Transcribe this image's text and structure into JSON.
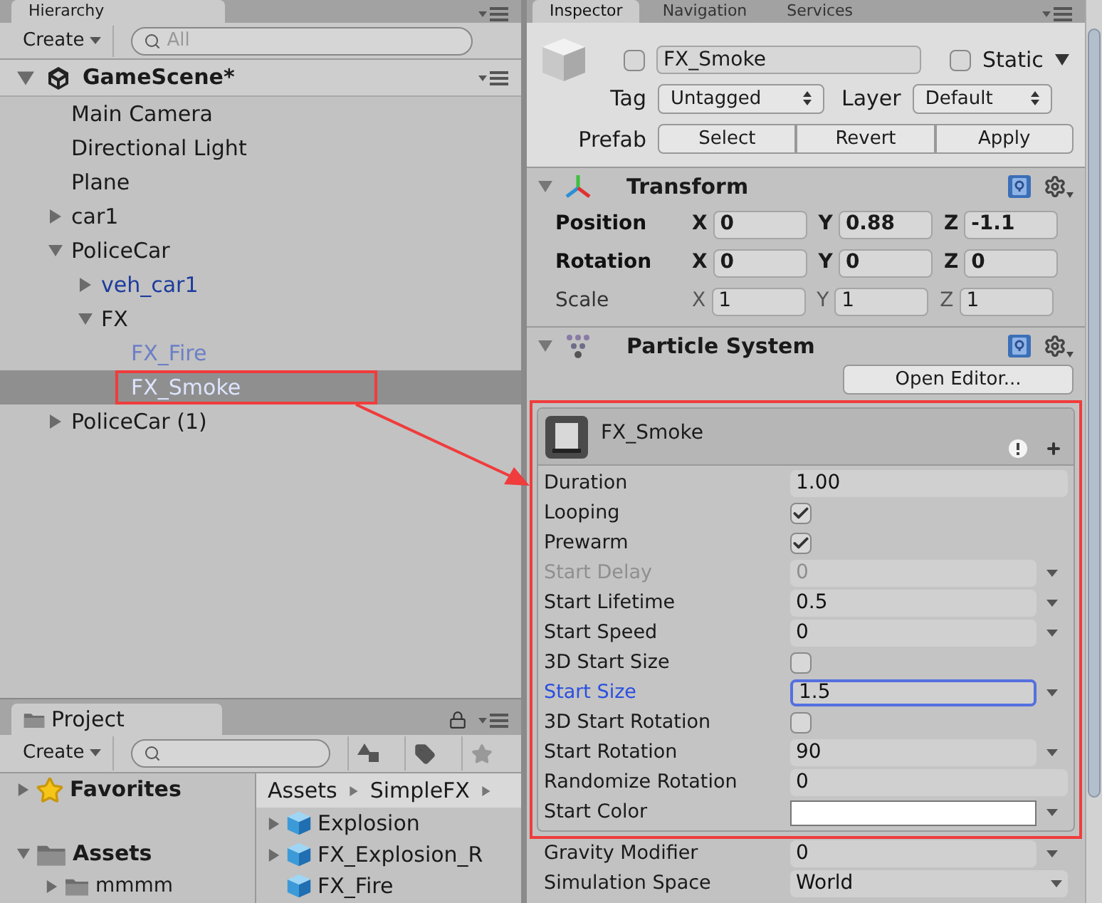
{
  "hierarchy": {
    "tab": "Hierarchy",
    "create_button": "Create",
    "search_placeholder": "All",
    "scene": {
      "name": "GameScene*",
      "expanded": true
    },
    "items": [
      {
        "label": "Main Camera",
        "kind": "object",
        "selected": false,
        "annotated": false
      },
      {
        "label": "Directional Light",
        "kind": "object",
        "selected": false,
        "annotated": false
      },
      {
        "label": "Plane",
        "kind": "object",
        "selected": false,
        "annotated": false
      },
      {
        "label": "car1",
        "kind": "object",
        "expanded": false,
        "selected": false,
        "annotated": false
      },
      {
        "label": "PoliceCar",
        "kind": "object",
        "expanded": true,
        "selected": false,
        "annotated": false,
        "children": [
          {
            "label": "veh_car1",
            "kind": "prefab",
            "expanded": false,
            "selected": false,
            "annotated": false
          },
          {
            "label": "FX",
            "kind": "object",
            "expanded": true,
            "selected": false,
            "annotated": false,
            "children": [
              {
                "label": "FX_Fire",
                "kind": "prefab_broken",
                "selected": false,
                "annotated": false
              },
              {
                "label": "FX_Smoke",
                "kind": "prefab_broken",
                "selected": true,
                "annotated": true
              }
            ]
          }
        ]
      },
      {
        "label": "PoliceCar (1)",
        "kind": "object",
        "expanded": false,
        "selected": false,
        "annotated": false
      }
    ]
  },
  "project": {
    "tab": "Project",
    "create_button": "Create",
    "folders": [
      {
        "label": "Favorites",
        "kind": "favorites",
        "expanded": false
      },
      {
        "label": "Assets",
        "kind": "folder",
        "expanded": true,
        "children": [
          {
            "label": "mmmm",
            "kind": "folder",
            "expanded": false
          }
        ]
      }
    ],
    "breadcrumb": [
      "Assets",
      "SimpleFX"
    ],
    "assets": [
      {
        "label": "Explosion",
        "expanded": false
      },
      {
        "label": "FX_Explosion_R",
        "expanded": false
      },
      {
        "label": "FX_Fire"
      }
    ]
  },
  "inspector": {
    "tabs": [
      {
        "label": "Inspector",
        "selected": true
      },
      {
        "label": "Navigation",
        "selected": false
      },
      {
        "label": "Services",
        "selected": false
      }
    ],
    "object": {
      "active": false,
      "name": "FX_Smoke",
      "static": false,
      "static_label": "Static",
      "tag_label": "Tag",
      "tag": "Untagged",
      "layer_label": "Layer",
      "layer": "Default",
      "prefab_label": "Prefab",
      "prefab_buttons": [
        "Select",
        "Revert",
        "Apply"
      ]
    },
    "transform": {
      "title": "Transform",
      "expanded": true,
      "rows": [
        {
          "label": "Position",
          "modified": true,
          "axes": [
            {
              "axis": "X",
              "value": "0"
            },
            {
              "axis": "Y",
              "value": "0.88"
            },
            {
              "axis": "Z",
              "value": "-1.1"
            }
          ]
        },
        {
          "label": "Rotation",
          "modified": true,
          "axes": [
            {
              "axis": "X",
              "value": "0"
            },
            {
              "axis": "Y",
              "value": "0"
            },
            {
              "axis": "Z",
              "value": "0"
            }
          ]
        },
        {
          "label": "Scale",
          "modified": false,
          "axes": [
            {
              "axis": "X",
              "value": "1"
            },
            {
              "axis": "Y",
              "value": "1"
            },
            {
              "axis": "Z",
              "value": "1"
            }
          ]
        }
      ]
    },
    "particle_system": {
      "title": "Particle System",
      "expanded": true,
      "open_editor_button": "Open Editor...",
      "annotated": true,
      "module": {
        "title": "FX_Smoke",
        "properties": [
          {
            "label": "Duration",
            "kind": "number",
            "value": "1.00",
            "menu": false,
            "disabled": false,
            "focused": false
          },
          {
            "label": "Looping",
            "kind": "checkbox",
            "checked": true,
            "menu": false,
            "disabled": false,
            "focused": false
          },
          {
            "label": "Prewarm",
            "kind": "checkbox",
            "checked": true,
            "menu": false,
            "disabled": false,
            "focused": false
          },
          {
            "label": "Start Delay",
            "kind": "number",
            "value": "0",
            "menu": true,
            "disabled": true,
            "focused": false
          },
          {
            "label": "Start Lifetime",
            "kind": "number",
            "value": "0.5",
            "menu": true,
            "disabled": false,
            "focused": false
          },
          {
            "label": "Start Speed",
            "kind": "number",
            "value": "0",
            "menu": true,
            "disabled": false,
            "focused": false
          },
          {
            "label": "3D Start Size",
            "kind": "checkbox",
            "checked": false,
            "menu": false,
            "disabled": false,
            "focused": false
          },
          {
            "label": "Start Size",
            "kind": "number",
            "value": "1.5",
            "menu": true,
            "disabled": false,
            "focused": true
          },
          {
            "label": "3D Start Rotation",
            "kind": "checkbox",
            "checked": false,
            "menu": false,
            "disabled": false,
            "focused": false
          },
          {
            "label": "Start Rotation",
            "kind": "number",
            "value": "90",
            "menu": true,
            "disabled": false,
            "focused": false
          },
          {
            "label": "Randomize Rotation",
            "kind": "number",
            "value": "0",
            "menu": false,
            "disabled": false,
            "focused": false
          },
          {
            "label": "Start Color",
            "kind": "color",
            "color": "#ffffff",
            "menu": true,
            "disabled": false,
            "focused": false
          }
        ]
      },
      "more_properties": [
        {
          "label": "Gravity Modifier",
          "kind": "number",
          "value": "0",
          "menu": true,
          "disabled": false,
          "focused": false
        },
        {
          "label": "Simulation Space",
          "kind": "dropdown",
          "value": "World",
          "menu": false,
          "disabled": false,
          "focused": false
        }
      ]
    }
  }
}
